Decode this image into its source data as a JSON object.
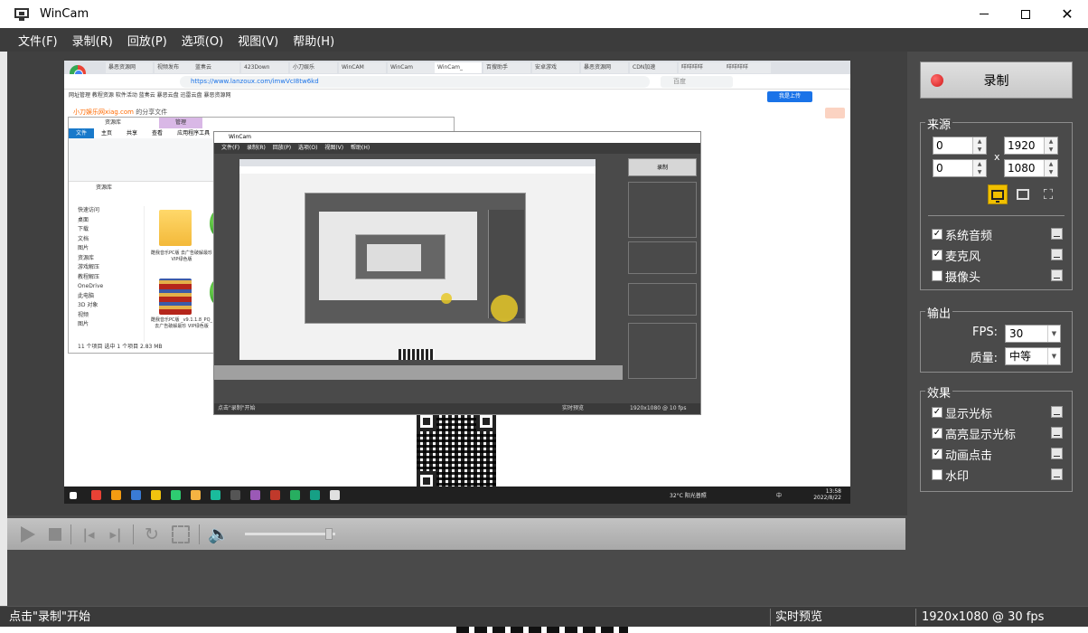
{
  "window": {
    "title": "WinCam",
    "minimize_symbol": "—",
    "maximize_symbol": "☐",
    "close_symbol": "✕"
  },
  "menu": [
    "文件(F)",
    "录制(R)",
    "回放(P)",
    "选项(O)",
    "视图(V)",
    "帮助(H)"
  ],
  "preview": {
    "browser": {
      "tabs": [
        "暴恶资源网",
        "视频发布",
        "蓝奏云",
        "423Down",
        "小刀娱乐",
        "WinCAM",
        "WinCam",
        "WinCam_",
        "百搜助手",
        "安卓游戏",
        "暴恶资源网",
        "CDN加速",
        "咩咩咩咩",
        "咩咩咩咩"
      ],
      "url": "https://www.lanzoux.com/imwVcI8tw6kd",
      "search_placeholder": "百度",
      "bookmarks": "网址管理   教程资源   软件活动   蓝奏云   暴恶云盘   迅雷云盘   暴恶资源网",
      "site_user_prefix": "小刀娱乐网xiag.com",
      "site_user_suffix": "的分享文件",
      "upload_label": "我是上传"
    },
    "explorer": {
      "title": "资源库",
      "ribbon_tab_highlight": "管理",
      "ribbon_tabs": [
        "文件",
        "主页",
        "共享",
        "查看",
        "应用程序工具"
      ],
      "address": "资源库",
      "nav_items": [
        "快速访问",
        "桌面",
        "下载",
        "文档",
        "图片",
        "资源库",
        "游戏解压",
        "教程解压",
        "OneDrive",
        "此电脑",
        "3D 对象",
        "视频",
        "图片"
      ],
      "file_caption_1": "酷我音乐PC版 去广告破解最珍VIP绿色版",
      "file_caption_2": "酷我音乐PC版 _v9.1.1.8_PQ_ 去广告破解最珍 VIP绿色版",
      "status": "11 个项目   选中 1 个项目  2.83 MB"
    },
    "nested_wincam": {
      "title": "WinCam",
      "menu": "文件(F) 录制(R) 回放(P) 选项(O) 视图(V) 帮助(H)",
      "record_label": "录制",
      "status_left": "点击\"录制\"开始",
      "status_mid": "实时预览",
      "status_right": "1920x1080 @ 10 fps"
    },
    "taskbar": {
      "weather": "32°C 阳光普照",
      "ime": "中",
      "time": "13:58",
      "date": "2022/8/22"
    }
  },
  "controls": {
    "play_icon": "play-icon",
    "stop_icon": "stop-icon",
    "prev_symbol": "|◂",
    "next_symbol": "▸|",
    "loop_symbol": "↻",
    "volume_symbol": "🔈",
    "volume_level": 0.97
  },
  "side": {
    "record_label": "录制",
    "source": {
      "title": "来源",
      "x": "0",
      "y": "0",
      "width": "1920",
      "height": "1080",
      "times": "x",
      "spin_arrows": "▲\n▼",
      "crop_symbol": "⛶",
      "modes": [
        "monitor-icon",
        "window-icon",
        "crop-icon"
      ]
    },
    "audio": [
      {
        "label": "系统音频",
        "checked": true
      },
      {
        "label": "麦克风",
        "checked": true
      },
      {
        "label": "摄像头",
        "checked": false
      }
    ],
    "output": {
      "title": "输出",
      "fps_label": "FPS:",
      "fps_value": "30",
      "quality_label": "质量:",
      "quality_value": "中等",
      "dropdown_symbol": "▼"
    },
    "effects": {
      "title": "效果",
      "items": [
        {
          "label": "显示光标",
          "checked": true
        },
        {
          "label": "高亮显示光标",
          "checked": true
        },
        {
          "label": "动画点击",
          "checked": true
        },
        {
          "label": "水印",
          "checked": false
        }
      ]
    },
    "check_mark": "✓"
  },
  "status": {
    "left": "点击\"录制\"开始",
    "middle": "实时预览",
    "right": "1920x1080 @ 30 fps"
  }
}
